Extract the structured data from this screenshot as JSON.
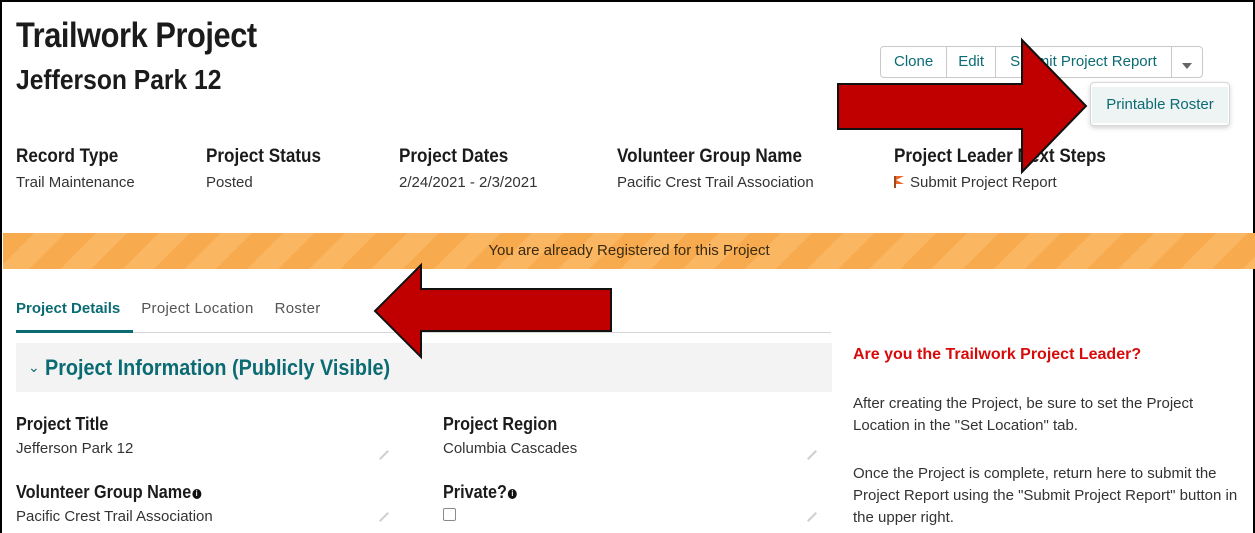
{
  "header": {
    "title": "Trailwork Project",
    "subtitle": "Jefferson Park 12"
  },
  "actions": {
    "clone": "Clone",
    "edit": "Edit",
    "submit_report": "Submit Project Report",
    "more_icon": "chevron-down-icon"
  },
  "dropdown": {
    "items": [
      "Printable Roster"
    ]
  },
  "highlights": [
    {
      "label": "Record Type",
      "value": "Trail Maintenance"
    },
    {
      "label": "Project Status",
      "value": "Posted"
    },
    {
      "label": "Project Dates",
      "value": "2/24/2021 - 2/3/2021"
    },
    {
      "label": "Volunteer Group Name",
      "value": "Pacific Crest Trail Association"
    },
    {
      "label": "Project Leader Next Steps",
      "value": "Submit Project Report",
      "icon": "flag-icon"
    }
  ],
  "banner": {
    "text": "You are already Registered for this Project",
    "color": "#f7ab4e"
  },
  "tabs": [
    {
      "label": "Project Details",
      "active": true
    },
    {
      "label": "Project Location",
      "active": false
    },
    {
      "label": "Roster",
      "active": false
    }
  ],
  "section": {
    "title": "Project Information (Publicly Visible)"
  },
  "fields": {
    "project_title": {
      "label": "Project Title",
      "value": "Jefferson Park 12"
    },
    "project_region": {
      "label": "Project Region",
      "value": "Columbia Cascades"
    },
    "volunteer_group": {
      "label": "Volunteer Group Name",
      "value": "Pacific Crest Trail Association"
    },
    "private": {
      "label": "Private?",
      "checked": false
    }
  },
  "sidebar": {
    "title": "Are you the Trailwork Project Leader?",
    "p1": "After creating the Project, be sure to set the Project Location in the \"Set Location\" tab.",
    "p2": "Once the Project is complete, return here to submit the Project Report using the \"Submit Project Report\" button in the upper right."
  },
  "colors": {
    "accent": "#0b6b73",
    "alert": "#d80b0b",
    "annotation_arrow": "#c00000"
  }
}
